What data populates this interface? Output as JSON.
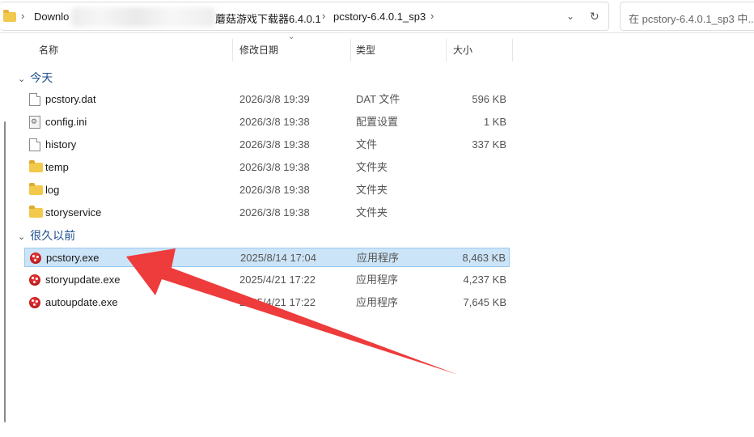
{
  "address_bar": {
    "crumbs": [
      "Downlo",
      "蘑菇游戏下载器6.4.0.1",
      "pcstory-6.4.0.1_sp3"
    ],
    "dropdown_icon": "chevron-down-icon",
    "refresh_icon": "refresh-icon"
  },
  "search": {
    "placeholder": "在 pcstory-6.4.0.1_sp3 中..."
  },
  "columns": {
    "name": "名称",
    "date": "修改日期",
    "type": "类型",
    "size": "大小"
  },
  "groups": [
    {
      "label": "今天",
      "files": [
        {
          "name": "pcstory.dat",
          "date": "2026/3/8 19:39",
          "type": "DAT 文件",
          "size": "596 KB",
          "icon": "file-icon"
        },
        {
          "name": "config.ini",
          "date": "2026/3/8 19:38",
          "type": "配置设置",
          "size": "1 KB",
          "icon": "config-file-icon"
        },
        {
          "name": "history",
          "date": "2026/3/8 19:38",
          "type": "文件",
          "size": "337 KB",
          "icon": "file-icon"
        },
        {
          "name": "temp",
          "date": "2026/3/8 19:38",
          "type": "文件夹",
          "size": "",
          "icon": "folder-icon"
        },
        {
          "name": "log",
          "date": "2026/3/8 19:38",
          "type": "文件夹",
          "size": "",
          "icon": "folder-icon"
        },
        {
          "name": "storyservice",
          "date": "2026/3/8 19:38",
          "type": "文件夹",
          "size": "",
          "icon": "folder-icon"
        }
      ]
    },
    {
      "label": "很久以前",
      "files": [
        {
          "name": "pcstory.exe",
          "date": "2025/8/14 17:04",
          "type": "应用程序",
          "size": "8,463 KB",
          "icon": "app-icon",
          "selected": true
        },
        {
          "name": "storyupdate.exe",
          "date": "2025/4/21 17:22",
          "type": "应用程序",
          "size": "4,237 KB",
          "icon": "app-icon"
        },
        {
          "name": "autoupdate.exe",
          "date": "2025/4/21 17:22",
          "type": "应用程序",
          "size": "7,645 KB",
          "icon": "app-icon"
        }
      ]
    }
  ],
  "colors": {
    "selection": "#cce4f7",
    "arrow": "#ee3b3b",
    "group_label": "#1f4f8f"
  }
}
